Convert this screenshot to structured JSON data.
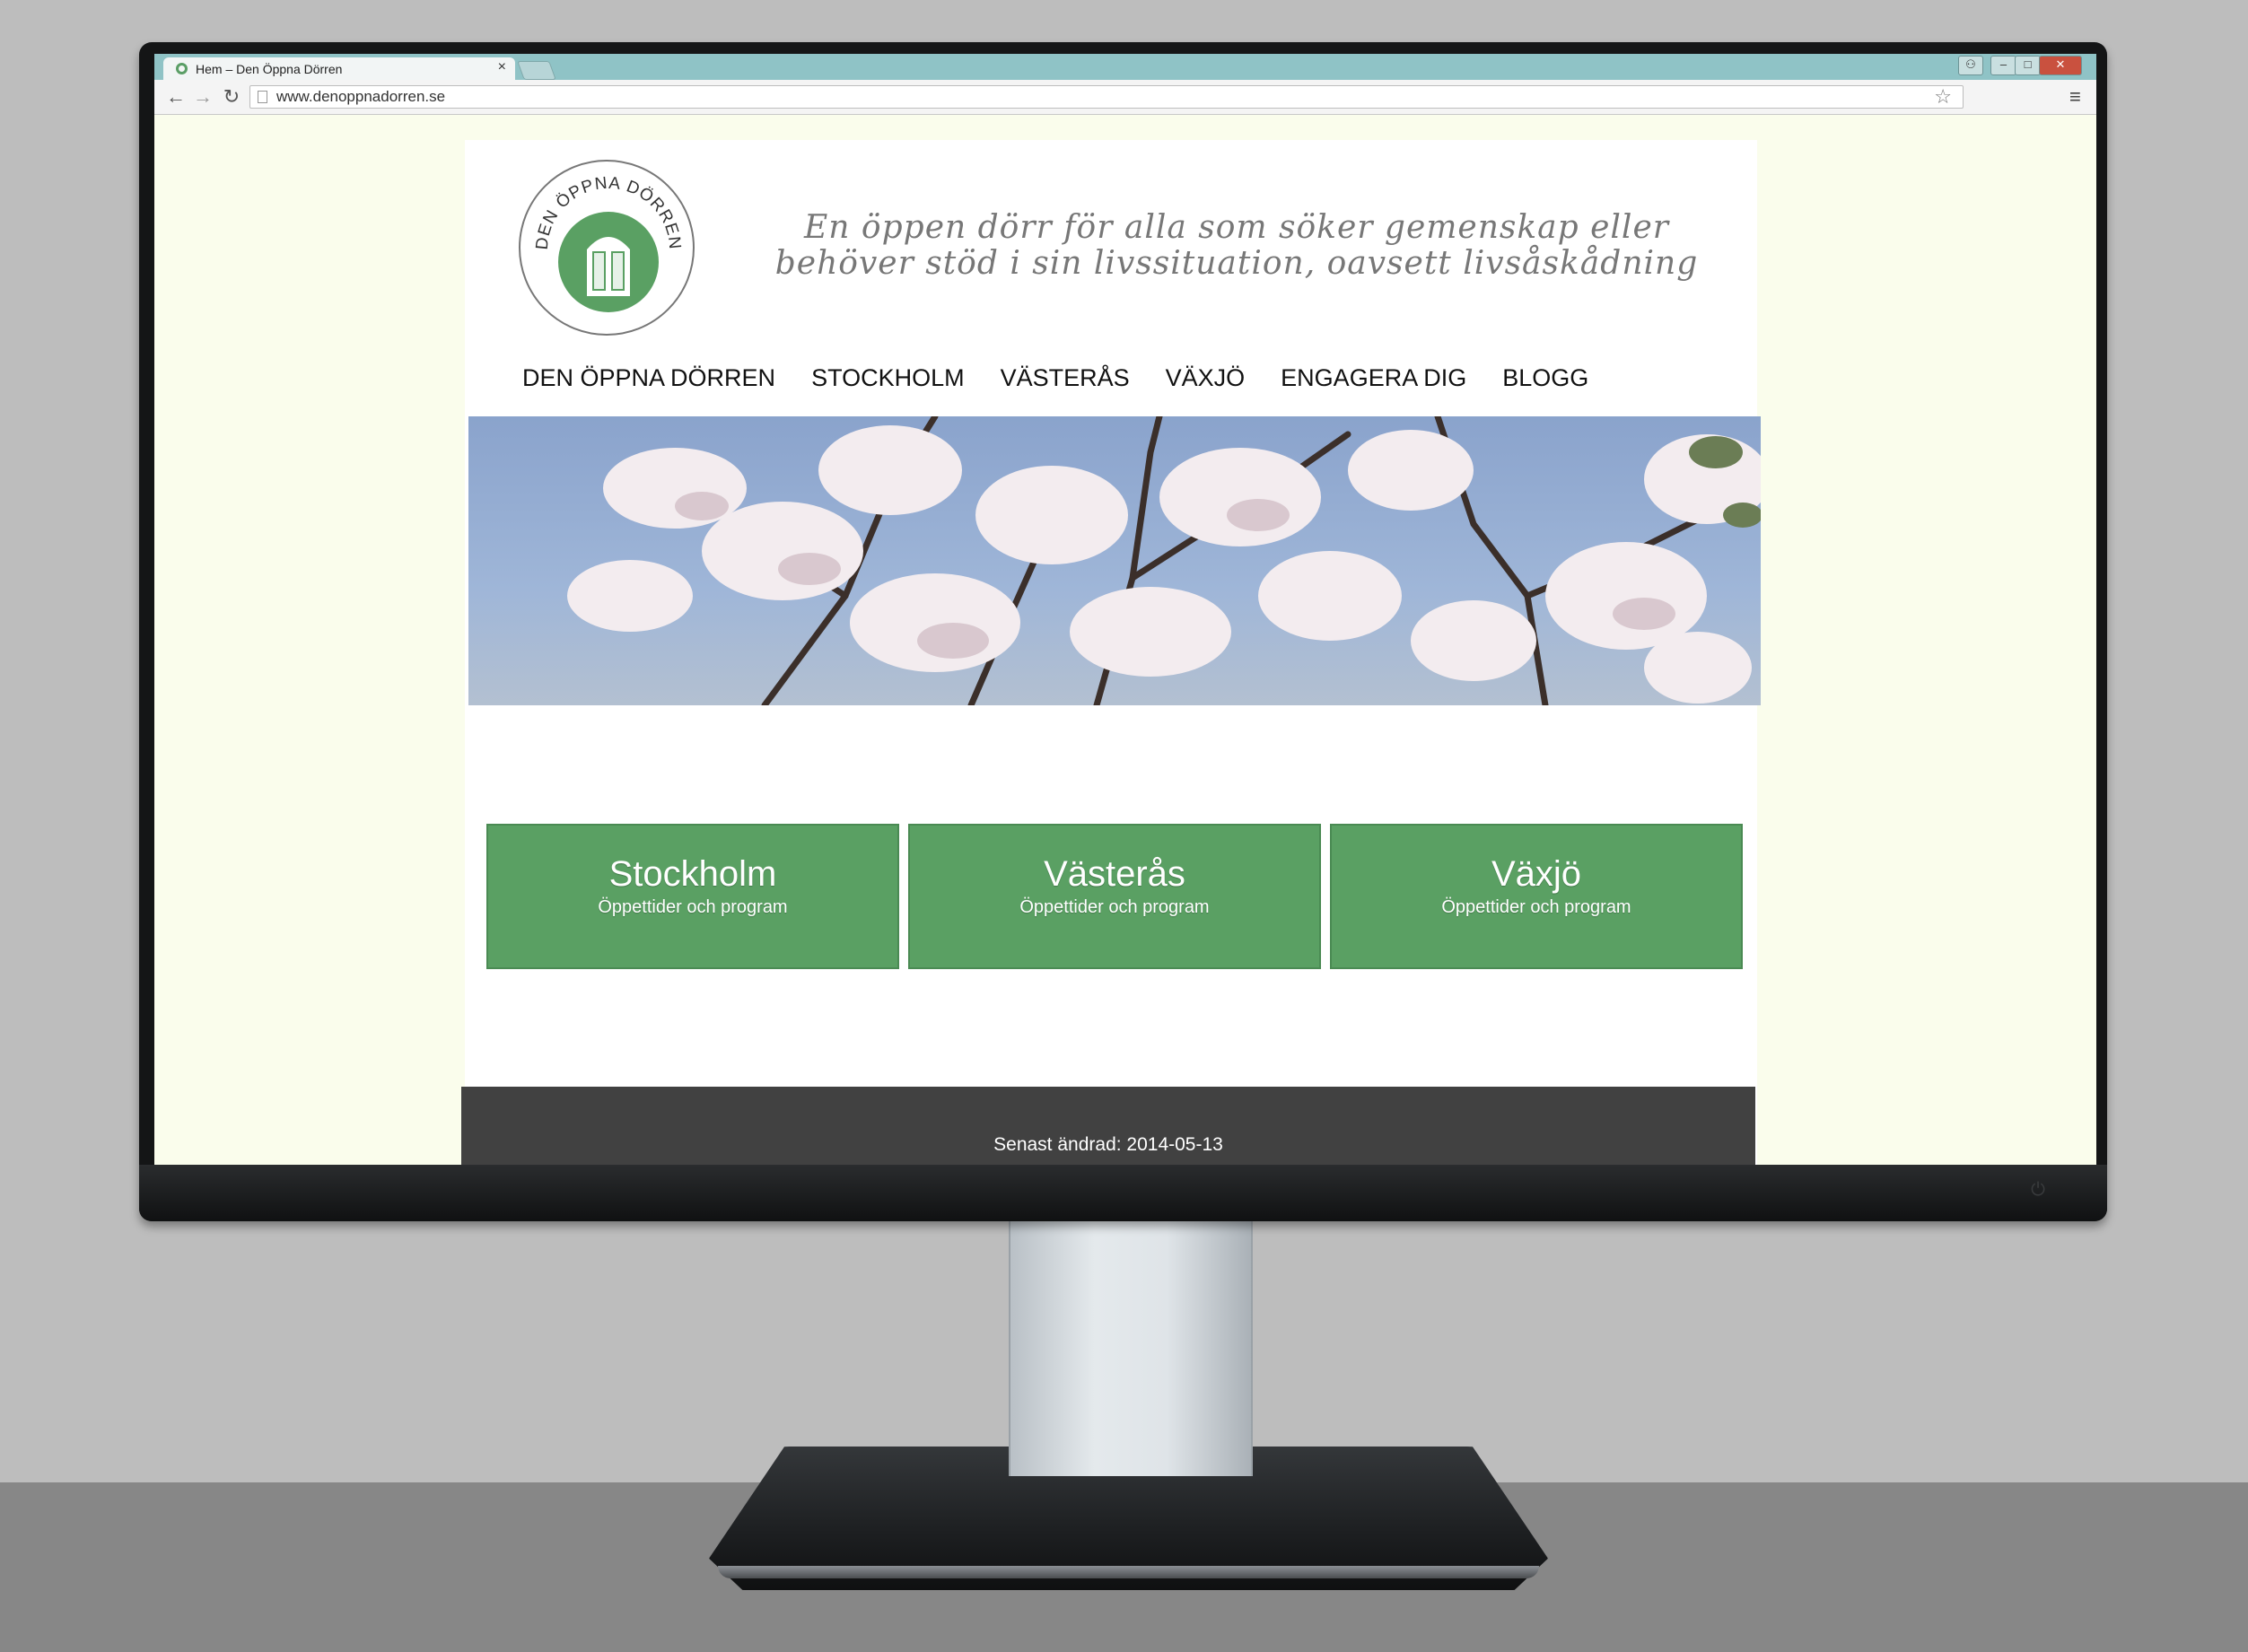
{
  "browser": {
    "tab_title": "Hem – Den Öppna Dörren",
    "url": "www.denoppnadorren.se",
    "icons": {
      "back": "arrow-left-icon",
      "forward": "arrow-right-icon",
      "reload": "reload-icon",
      "bookmark": "star-icon",
      "menu": "hamburger-menu-icon",
      "close_tab": "close-icon"
    }
  },
  "site": {
    "logo_text": "DEN ÖPPNA DÖRREN",
    "tagline_line1": "En öppen dörr för alla som söker gemenskap eller",
    "tagline_line2": "behöver stöd i sin livssituation, oavsett livsåskådning",
    "nav": [
      {
        "label": "DEN ÖPPNA DÖRREN"
      },
      {
        "label": "STOCKHOLM"
      },
      {
        "label": "VÄSTERÅS"
      },
      {
        "label": "VÄXJÖ"
      },
      {
        "label": "ENGAGERA DIG"
      },
      {
        "label": "BLOGG"
      }
    ],
    "cards": [
      {
        "title": "Stockholm",
        "subtitle": "Öppettider och program"
      },
      {
        "title": "Västerås",
        "subtitle": "Öppettider och program"
      },
      {
        "title": "Växjö",
        "subtitle": "Öppettider och program"
      }
    ],
    "footer": "Senast ändrad: 2014-05-13",
    "colors": {
      "accent_green": "#5aa063",
      "page_background": "#fafdec",
      "footer_background": "#414141"
    }
  }
}
